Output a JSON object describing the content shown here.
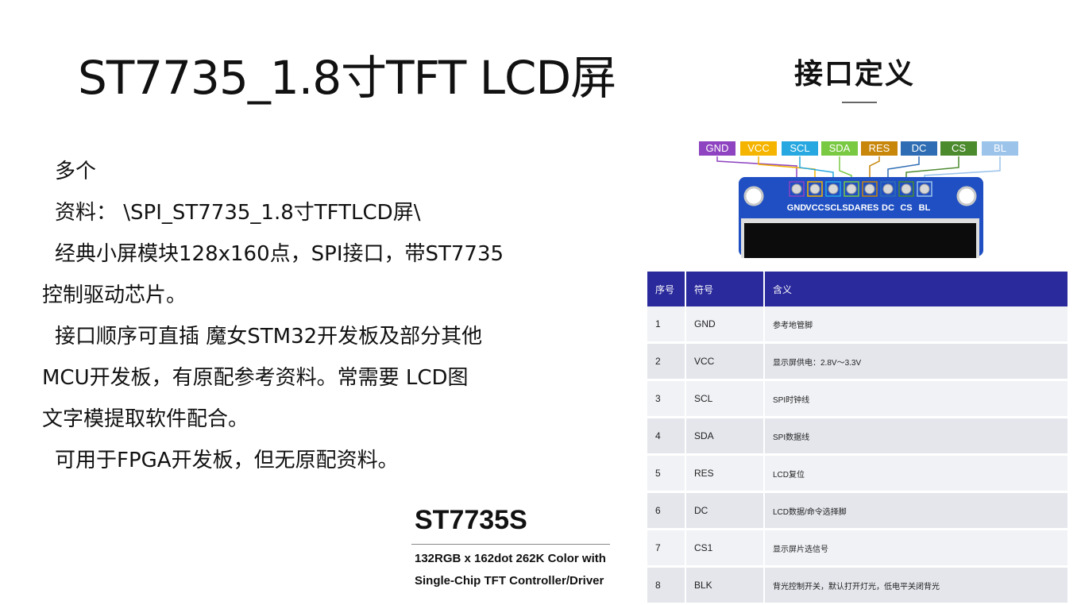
{
  "title": "ST7735_1.8寸TFT LCD屏",
  "body": [
    "多个",
    "资料： \\SPI_ST7735_1.8寸TFTLCD屏\\",
    "经典小屏模块128x160点，SPI接口，带ST7735",
    "控制驱动芯片。",
    "接口顺序可直插 魔女STM32开发板及部分其他",
    "MCU开发板，有原配参考资料。常需要 LCD图",
    "文字模提取软件配合。",
    "可用于FPGA开发板，但无原配资料。"
  ],
  "interface": {
    "title": "接口定义",
    "pins": [
      {
        "label": "GND",
        "color": "#8e44c0"
      },
      {
        "label": "VCC",
        "color": "#f5b400"
      },
      {
        "label": "SCL",
        "color": "#27a8e0"
      },
      {
        "label": "SDA",
        "color": "#7ac943"
      },
      {
        "label": "RES",
        "color": "#c8860a"
      },
      {
        "label": "DC",
        "color": "#2e6db3"
      },
      {
        "label": "CS",
        "color": "#4c8a2e"
      },
      {
        "label": "BL",
        "color": "#9cc3ea"
      }
    ],
    "board_labels": [
      "GND",
      "VCC",
      "SCL",
      "SDA",
      "RES",
      "DC",
      "CS",
      "BL"
    ],
    "table": {
      "headers": [
        "序号",
        "符号",
        "含义"
      ],
      "rows": [
        [
          "1",
          "GND",
          "参考地管脚"
        ],
        [
          "2",
          "VCC",
          "显示屏供电：2.8V～3.3V"
        ],
        [
          "3",
          "SCL",
          "SPI时钟线"
        ],
        [
          "4",
          "SDA",
          "SPI数据线"
        ],
        [
          "5",
          "RES",
          "LCD复位"
        ],
        [
          "6",
          "DC",
          "LCD数据/命令选择脚"
        ],
        [
          "7",
          "CS1",
          "显示屏片选信号"
        ],
        [
          "8",
          "BLK",
          "背光控制开关，默认打开灯光，低电平关闭背光"
        ]
      ]
    }
  },
  "chip": {
    "name": "ST7735S",
    "desc_line1": "132RGB x 162dot 262K Color with",
    "desc_line2": "Single-Chip TFT Controller/Driver"
  }
}
